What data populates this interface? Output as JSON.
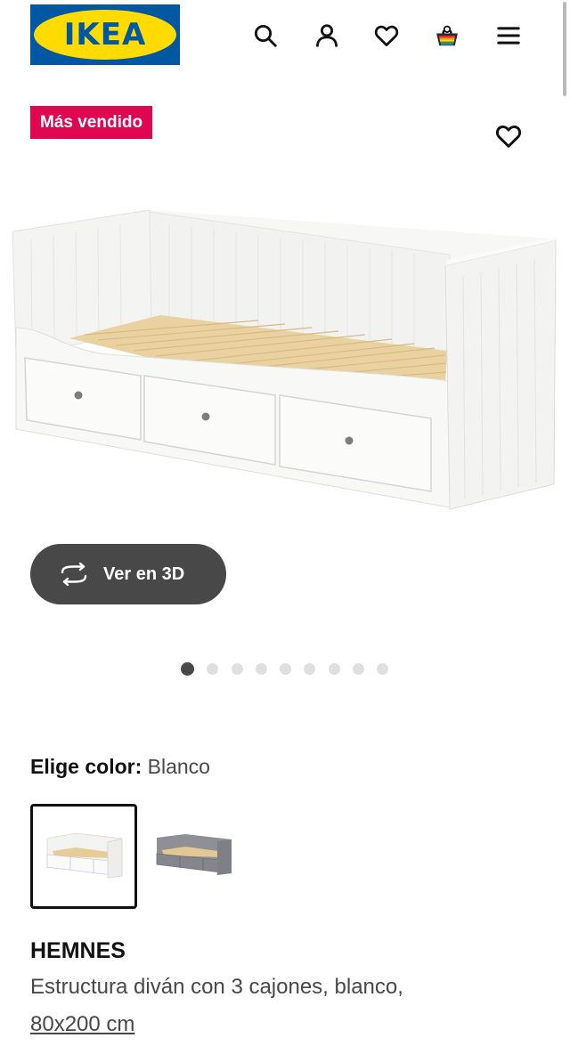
{
  "header": {
    "logo_text": "IKEA",
    "icons": [
      "search-icon",
      "user-icon",
      "heart-icon",
      "cart-icon",
      "menu-icon"
    ]
  },
  "product": {
    "badge": "Más vendido",
    "view_3d_label": "Ver en 3D",
    "gallery": {
      "total": 9,
      "active": 1
    },
    "color_label": "Elige color:",
    "color_value": "Blanco",
    "swatches": [
      "white",
      "grey"
    ],
    "name": "HEMNES",
    "description": "Estructura diván con 3 cajones, blanco,",
    "size": "80x200 cm"
  },
  "colors": {
    "brand_blue": "#0058a3",
    "brand_yellow": "#ffdb00",
    "badge_red": "#e00751",
    "button_dark": "#484848"
  }
}
